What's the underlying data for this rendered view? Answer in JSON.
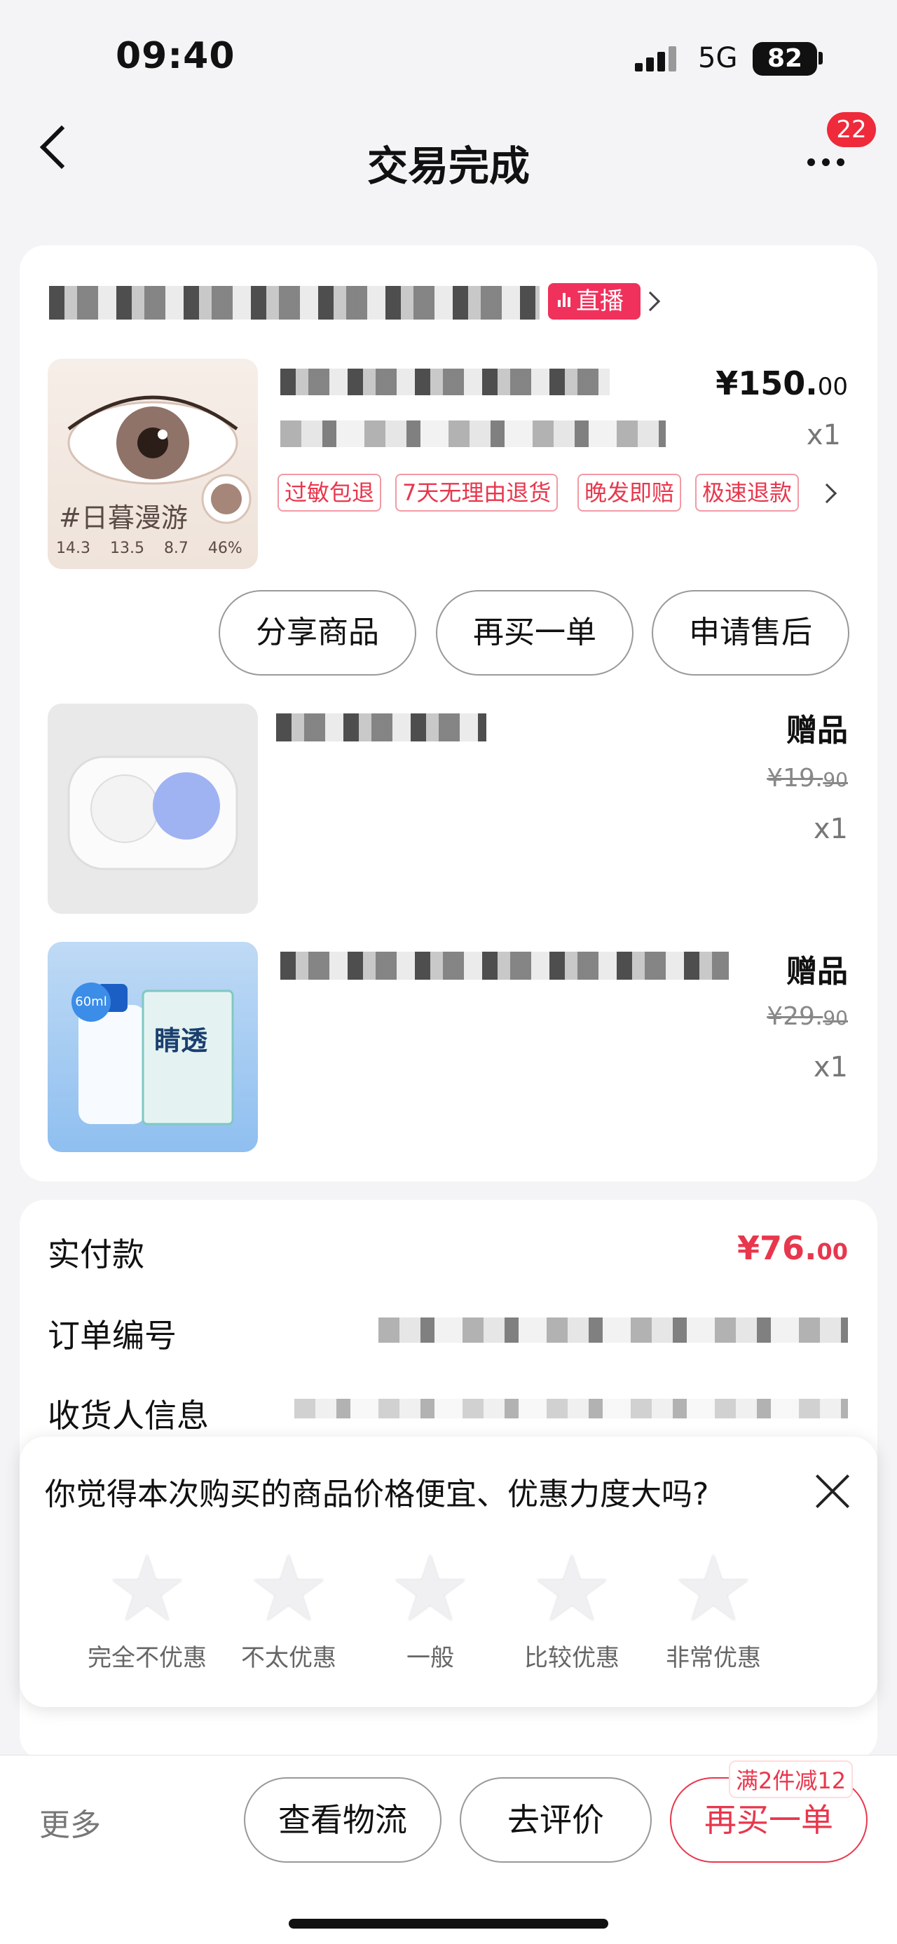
{
  "status_bar": {
    "time": "09:40",
    "network": "5G",
    "battery": "82"
  },
  "nav": {
    "title": "交易完成",
    "badge": "22"
  },
  "store": {
    "live_label": "直播"
  },
  "items": [
    {
      "price_main": "¥150.",
      "price_cents": "00",
      "qty": "x1",
      "thumb_caption": "#日暮漫游",
      "thumb_specs": [
        "14.3",
        "13.5",
        "8.7",
        "46%"
      ],
      "tags": [
        "过敏包退",
        "7天无理由退货",
        "晚发即赔",
        "极速退款"
      ],
      "actions": [
        "分享商品",
        "再买一单",
        "申请售后"
      ]
    },
    {
      "gift_label": "赠品",
      "orig_main": "¥19.",
      "orig_cents": "90",
      "qty": "x1"
    },
    {
      "gift_label": "赠品",
      "orig_main": "¥29.",
      "orig_cents": "90",
      "qty": "x1",
      "thumb_text": "睛透",
      "thumb_badge": "60ml"
    }
  ],
  "order": {
    "paid_label": "实付款",
    "paid_main": "¥76.",
    "paid_cents": "00",
    "order_no_label": "订单编号",
    "receiver_label": "收货人信息"
  },
  "survey": {
    "question": "你觉得本次购买的商品价格便宜、优惠力度大吗?",
    "ratings": [
      "完全不优惠",
      "不太优惠",
      "一般",
      "比较优惠",
      "非常优惠"
    ]
  },
  "bottom_bar": {
    "more": "更多",
    "logistics": "查看物流",
    "review": "去评价",
    "buy_again": "再买一单",
    "promo": "满2件减12"
  },
  "colors": {
    "accent": "#e8374d",
    "live": "#f0315b",
    "badge": "#ee2a3b"
  }
}
